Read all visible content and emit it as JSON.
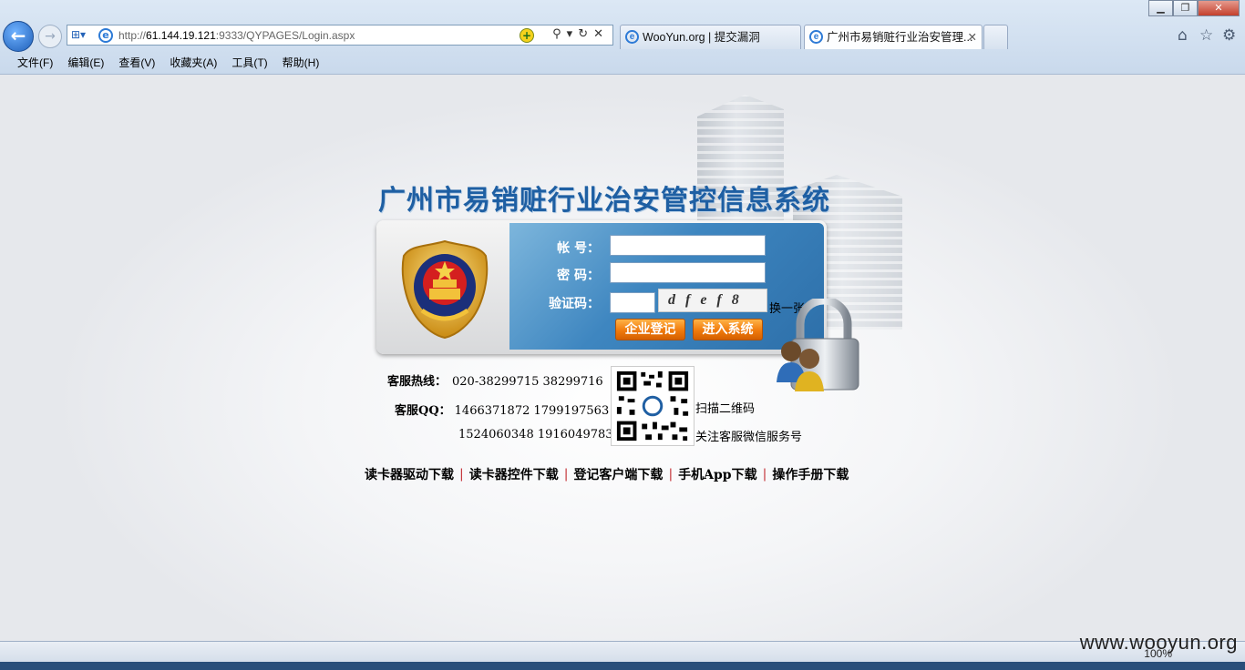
{
  "browser": {
    "address_url_prefix": "http://",
    "address_host": "61.144.19.121",
    "address_rest": ":9333/QYPAGES/Login.aspx",
    "tabs": [
      {
        "label": "WooYun.org | 提交漏洞",
        "active": false
      },
      {
        "label": "广州市易销赃行业治安管理...",
        "active": true
      }
    ],
    "menu": [
      "文件(F)",
      "编辑(E)",
      "查看(V)",
      "收藏夹(A)",
      "工具(T)",
      "帮助(H)"
    ],
    "zoom": "100%"
  },
  "page": {
    "title": "广州市易销赃行业治安管控信息系统",
    "login": {
      "account_label": "帐  号：",
      "password_label": "密  码：",
      "captcha_label": "验证码：",
      "captcha_text": "dfef8",
      "swap_label": "换一张",
      "register_button": "企业登记",
      "enter_button": "进入系统"
    },
    "support": {
      "hotline_label": "客服热线：",
      "hotline_numbers": "020-38299715 38299716",
      "qq_label": "客服QQ：",
      "qq_line1": "1466371872 1799197563",
      "qq_line2": "1524060348 1916049783",
      "qr_caption1": "扫描二维码",
      "qr_caption2": "关注客服微信服务号"
    },
    "download_links": [
      "读卡器驱动下载",
      "读卡器控件下载",
      "登记客户端下载",
      "手机App下载",
      "操作手册下载"
    ],
    "link_separator": "|"
  },
  "watermark": "www.wooyun.org"
}
